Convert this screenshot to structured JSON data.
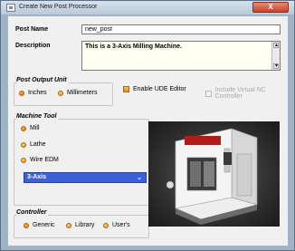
{
  "window": {
    "title": "Create New Post Processor",
    "close_label": "X"
  },
  "form": {
    "post_name_label": "Post Name",
    "post_name_value": "new_post",
    "description_label": "Description",
    "description_value": "This is a 3-Axis Milling Machine."
  },
  "post_output_unit": {
    "title": "Post Output Unit",
    "options": [
      "Inches",
      "Millimeters"
    ],
    "selected": "Inches",
    "enable_ude_editor_label": "Enable UDE Editor",
    "include_vnc_label": "Include Virtual NC Controller"
  },
  "machine_tool": {
    "title": "Machine Tool",
    "options": [
      "Mill",
      "Lathe",
      "Wire EDM"
    ],
    "selected": "Mill",
    "axis_selected": "3-Axis"
  },
  "controller": {
    "title": "Controller",
    "options": [
      "Generic",
      "Library",
      "User's"
    ],
    "selected": "Generic"
  },
  "colors": {
    "title_bar": "#c7d5e4",
    "select_highlight": "#3d5fd9",
    "radio_accent": "#e08a16"
  }
}
